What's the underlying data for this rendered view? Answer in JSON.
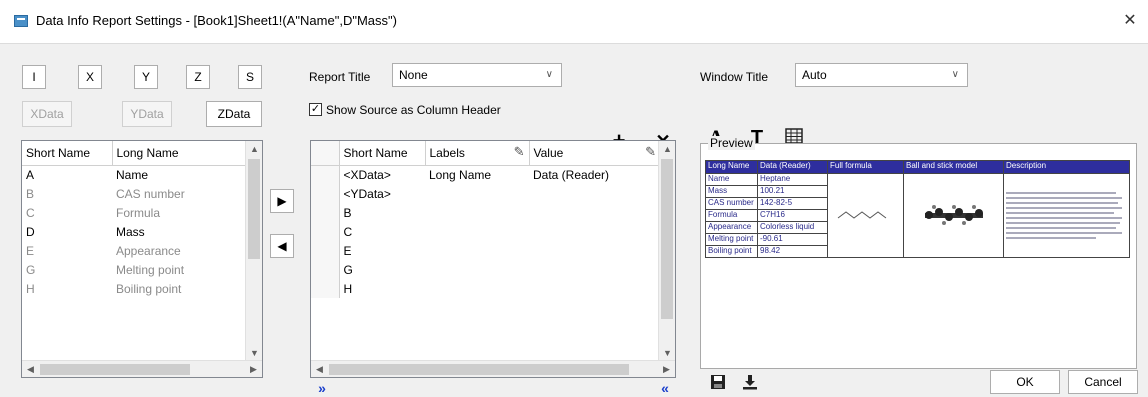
{
  "window": {
    "title": "Data Info Report Settings - [Book1]Sheet1!(A\"Name\",D\"Mass\")",
    "close_glyph": "✕"
  },
  "left": {
    "col_buttons": [
      "I",
      "X",
      "Y",
      "Z",
      "S"
    ],
    "data_buttons": [
      "XData",
      "YData",
      "ZData"
    ],
    "headers": [
      "Short Name",
      "Long Name"
    ],
    "rows": [
      {
        "short": "A",
        "long": "Name",
        "style": "normal"
      },
      {
        "short": "B",
        "long": "CAS number",
        "style": "gray"
      },
      {
        "short": "C",
        "long": "Formula",
        "style": "gray"
      },
      {
        "short": "D",
        "long": "Mass",
        "style": "normal"
      },
      {
        "short": "E",
        "long": "Appearance",
        "style": "gray"
      },
      {
        "short": "G",
        "long": "Melting point",
        "style": "gray"
      },
      {
        "short": "H",
        "long": "Boiling point",
        "style": "gray"
      }
    ]
  },
  "middle": {
    "report_title_label": "Report Title",
    "report_title_value": "None",
    "show_source_label": "Show Source as Column Header",
    "show_source_checked": true,
    "add_glyph": "+",
    "delete_glyph": "✕",
    "move_right_glyph": "▶",
    "move_left_glyph": "◀",
    "expand_glyph": "»",
    "collapse_glyph": "«",
    "headers": [
      "Short Name",
      "Labels",
      "Value"
    ],
    "rows": [
      {
        "short": "<XData>",
        "label": "Long Name",
        "value": "Data (Reader)"
      },
      {
        "short": "<YData>",
        "label": "",
        "value": ""
      },
      {
        "short": "B",
        "label": "",
        "value": ""
      },
      {
        "short": "C",
        "label": "",
        "value": ""
      },
      {
        "short": "E",
        "label": "",
        "value": ""
      },
      {
        "short": "G",
        "label": "",
        "value": ""
      },
      {
        "short": "H",
        "label": "",
        "value": ""
      }
    ]
  },
  "right": {
    "window_title_label": "Window Title",
    "window_title_value": "Auto",
    "font_btn": "A",
    "text_btn": "T",
    "preview_label": "Preview",
    "preview_headers": [
      "Long Name",
      "Data (Reader)",
      "Full formula",
      "Ball and stick model",
      "Description"
    ],
    "preview_rows": [
      [
        "Name",
        "Heptane"
      ],
      [
        "Mass",
        "100.21"
      ],
      [
        "CAS number",
        "142-82-5"
      ],
      [
        "Formula",
        "C7H16"
      ],
      [
        "Appearance",
        "Colorless liquid"
      ],
      [
        "Melting point",
        "-90.61"
      ],
      [
        "Boiling point",
        "98.42"
      ]
    ],
    "ok_label": "OK",
    "cancel_label": "Cancel"
  },
  "colors": {
    "preview_header_bg": "#2e2e9e",
    "selected_row_bg": "#cce8ff",
    "accent_blue": "#1a3fcc"
  }
}
